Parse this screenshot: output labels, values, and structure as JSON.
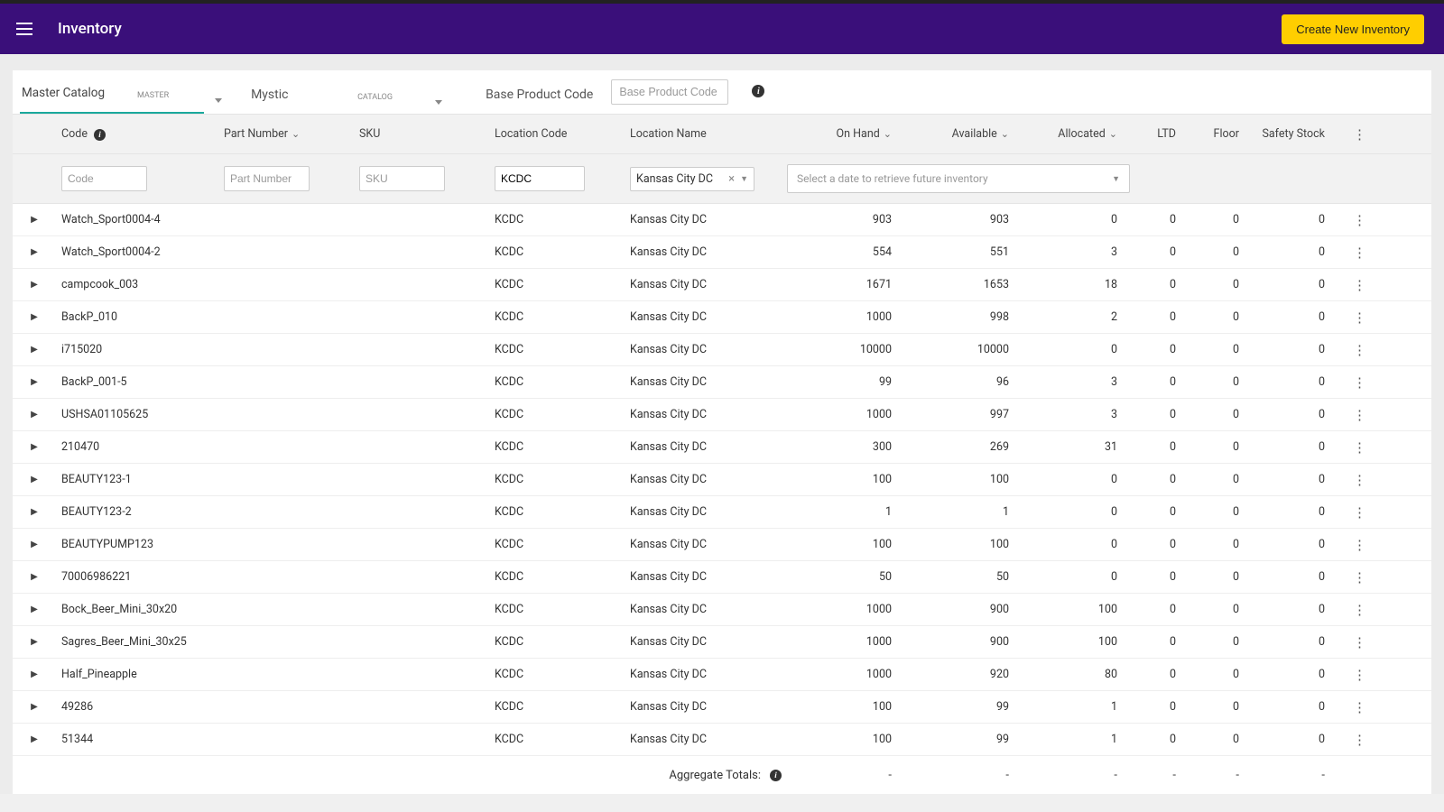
{
  "header": {
    "title": "Inventory",
    "create_button": "Create New Inventory"
  },
  "filters": {
    "master_catalog_label": "Master Catalog",
    "master_tag": "MASTER",
    "catalog_label": "Mystic",
    "catalog_tag": "CATALOG",
    "base_product_label": "Base Product Code",
    "base_product_placeholder": "Base Product Code"
  },
  "columns": {
    "code": "Code",
    "part_number": "Part Number",
    "sku": "SKU",
    "location_code": "Location Code",
    "location_name": "Location Name",
    "on_hand": "On Hand",
    "available": "Available",
    "allocated": "Allocated",
    "ltd": "LTD",
    "floor": "Floor",
    "safety_stock": "Safety Stock"
  },
  "grid_filters": {
    "code_placeholder": "Code",
    "part_number_placeholder": "Part Number",
    "sku_placeholder": "SKU",
    "location_code_value": "KCDC",
    "location_name_value": "Kansas City DC",
    "future_placeholder": "Select a date to retrieve future inventory"
  },
  "rows": [
    {
      "code": "Watch_Sport0004-4",
      "part": "",
      "sku": "",
      "loc_code": "KCDC",
      "loc_name": "Kansas City DC",
      "on_hand": "903",
      "available": "903",
      "allocated": "0",
      "ltd": "0",
      "floor": "0",
      "safety": "0"
    },
    {
      "code": "Watch_Sport0004-2",
      "part": "",
      "sku": "",
      "loc_code": "KCDC",
      "loc_name": "Kansas City DC",
      "on_hand": "554",
      "available": "551",
      "allocated": "3",
      "ltd": "0",
      "floor": "0",
      "safety": "0"
    },
    {
      "code": "campcook_003",
      "part": "",
      "sku": "",
      "loc_code": "KCDC",
      "loc_name": "Kansas City DC",
      "on_hand": "1671",
      "available": "1653",
      "allocated": "18",
      "ltd": "0",
      "floor": "0",
      "safety": "0"
    },
    {
      "code": "BackP_010",
      "part": "",
      "sku": "",
      "loc_code": "KCDC",
      "loc_name": "Kansas City DC",
      "on_hand": "1000",
      "available": "998",
      "allocated": "2",
      "ltd": "0",
      "floor": "0",
      "safety": "0"
    },
    {
      "code": "i715020",
      "part": "",
      "sku": "",
      "loc_code": "KCDC",
      "loc_name": "Kansas City DC",
      "on_hand": "10000",
      "available": "10000",
      "allocated": "0",
      "ltd": "0",
      "floor": "0",
      "safety": "0"
    },
    {
      "code": "BackP_001-5",
      "part": "",
      "sku": "",
      "loc_code": "KCDC",
      "loc_name": "Kansas City DC",
      "on_hand": "99",
      "available": "96",
      "allocated": "3",
      "ltd": "0",
      "floor": "0",
      "safety": "0"
    },
    {
      "code": "USHSA01105625",
      "part": "",
      "sku": "",
      "loc_code": "KCDC",
      "loc_name": "Kansas City DC",
      "on_hand": "1000",
      "available": "997",
      "allocated": "3",
      "ltd": "0",
      "floor": "0",
      "safety": "0"
    },
    {
      "code": "210470",
      "part": "",
      "sku": "",
      "loc_code": "KCDC",
      "loc_name": "Kansas City DC",
      "on_hand": "300",
      "available": "269",
      "allocated": "31",
      "ltd": "0",
      "floor": "0",
      "safety": "0"
    },
    {
      "code": "BEAUTY123-1",
      "part": "",
      "sku": "",
      "loc_code": "KCDC",
      "loc_name": "Kansas City DC",
      "on_hand": "100",
      "available": "100",
      "allocated": "0",
      "ltd": "0",
      "floor": "0",
      "safety": "0"
    },
    {
      "code": "BEAUTY123-2",
      "part": "",
      "sku": "",
      "loc_code": "KCDC",
      "loc_name": "Kansas City DC",
      "on_hand": "1",
      "available": "1",
      "allocated": "0",
      "ltd": "0",
      "floor": "0",
      "safety": "0"
    },
    {
      "code": "BEAUTYPUMP123",
      "part": "",
      "sku": "",
      "loc_code": "KCDC",
      "loc_name": "Kansas City DC",
      "on_hand": "100",
      "available": "100",
      "allocated": "0",
      "ltd": "0",
      "floor": "0",
      "safety": "0"
    },
    {
      "code": "70006986221",
      "part": "",
      "sku": "",
      "loc_code": "KCDC",
      "loc_name": "Kansas City DC",
      "on_hand": "50",
      "available": "50",
      "allocated": "0",
      "ltd": "0",
      "floor": "0",
      "safety": "0"
    },
    {
      "code": "Bock_Beer_Mini_30x20",
      "part": "",
      "sku": "",
      "loc_code": "KCDC",
      "loc_name": "Kansas City DC",
      "on_hand": "1000",
      "available": "900",
      "allocated": "100",
      "ltd": "0",
      "floor": "0",
      "safety": "0"
    },
    {
      "code": "Sagres_Beer_Mini_30x25",
      "part": "",
      "sku": "",
      "loc_code": "KCDC",
      "loc_name": "Kansas City DC",
      "on_hand": "1000",
      "available": "900",
      "allocated": "100",
      "ltd": "0",
      "floor": "0",
      "safety": "0"
    },
    {
      "code": "Half_Pineapple",
      "part": "",
      "sku": "",
      "loc_code": "KCDC",
      "loc_name": "Kansas City DC",
      "on_hand": "1000",
      "available": "920",
      "allocated": "80",
      "ltd": "0",
      "floor": "0",
      "safety": "0"
    },
    {
      "code": "49286",
      "part": "",
      "sku": "",
      "loc_code": "KCDC",
      "loc_name": "Kansas City DC",
      "on_hand": "100",
      "available": "99",
      "allocated": "1",
      "ltd": "0",
      "floor": "0",
      "safety": "0"
    },
    {
      "code": "51344",
      "part": "",
      "sku": "",
      "loc_code": "KCDC",
      "loc_name": "Kansas City DC",
      "on_hand": "100",
      "available": "99",
      "allocated": "1",
      "ltd": "0",
      "floor": "0",
      "safety": "0"
    }
  ],
  "totals": {
    "label": "Aggregate Totals:",
    "on_hand": "-",
    "available": "-",
    "allocated": "-",
    "ltd": "-",
    "floor": "-",
    "safety": "-"
  }
}
